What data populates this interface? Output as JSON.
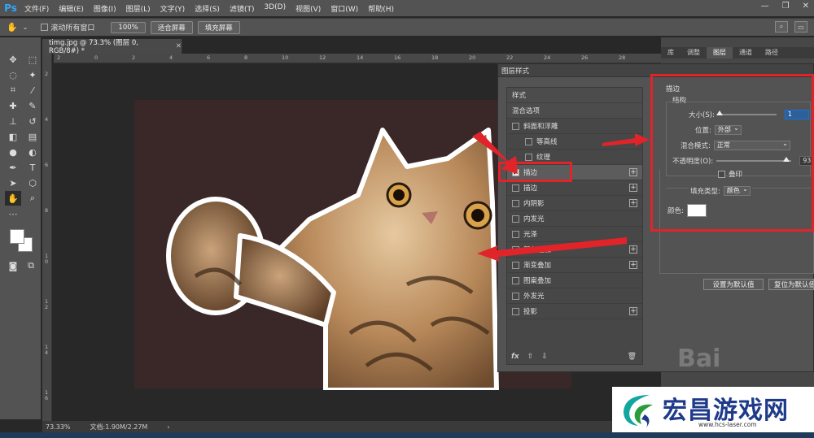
{
  "app": {
    "logo": "Ps"
  },
  "menu": [
    "文件(F)",
    "编辑(E)",
    "图像(I)",
    "图层(L)",
    "文字(Y)",
    "选择(S)",
    "滤镜(T)",
    "3D(D)",
    "视图(V)",
    "窗口(W)",
    "帮助(H)"
  ],
  "options": {
    "scroll_all_label": "滚动所有窗口",
    "zoom": "100%",
    "fit_screen": "适合屏幕",
    "fill_screen": "填充屏幕"
  },
  "document": {
    "tab_title": "timg.jpg @ 73.3% (图层 0, RGB/8#) *",
    "ruler_top": [
      "2",
      "0",
      "2",
      "4",
      "6",
      "8",
      "10",
      "12",
      "14",
      "16",
      "18",
      "20",
      "22",
      "24",
      "26",
      "28"
    ],
    "ruler_left": [
      "2",
      "4",
      "6",
      "8",
      "1\n0",
      "1\n2",
      "1\n4",
      "1\n6"
    ]
  },
  "status": {
    "zoom": "73.33%",
    "doc_info": "文档:1.90M/2.27M"
  },
  "panel_tabs": [
    "库",
    "调整",
    "图层",
    "通道",
    "路径"
  ],
  "dialog": {
    "title": "图层样式",
    "styles_header": "样式",
    "blend_options": "混合选项",
    "items": [
      {
        "label": "斜面和浮雕",
        "checked": false,
        "plus": false,
        "indent": false
      },
      {
        "label": "等高线",
        "checked": false,
        "plus": false,
        "indent": true
      },
      {
        "label": "纹理",
        "checked": false,
        "plus": false,
        "indent": true
      },
      {
        "label": "描边",
        "checked": true,
        "plus": true,
        "indent": false
      },
      {
        "label": "描边",
        "checked": false,
        "plus": true,
        "indent": false
      },
      {
        "label": "内阴影",
        "checked": false,
        "plus": true,
        "indent": false
      },
      {
        "label": "内发光",
        "checked": false,
        "plus": false,
        "indent": false
      },
      {
        "label": "光泽",
        "checked": false,
        "plus": false,
        "indent": false
      },
      {
        "label": "颜色叠加",
        "checked": false,
        "plus": true,
        "indent": false
      },
      {
        "label": "渐变叠加",
        "checked": false,
        "plus": true,
        "indent": false
      },
      {
        "label": "图案叠加",
        "checked": false,
        "plus": false,
        "indent": false
      },
      {
        "label": "外发光",
        "checked": false,
        "plus": false,
        "indent": false
      },
      {
        "label": "投影",
        "checked": false,
        "plus": true,
        "indent": false
      }
    ],
    "footer_fx": "fx",
    "stroke": {
      "title": "描边",
      "structure": "结构",
      "size_label": "大小(S):",
      "size_value": "1",
      "position_label": "位置:",
      "position_value": "外部",
      "blend_label": "混合模式:",
      "blend_value": "正常",
      "opacity_label": "不透明度(O):",
      "opacity_value": "93",
      "opacity_level": 0.93,
      "overprint_label": "叠印",
      "fill_type_label": "填充类型:",
      "fill_type_value": "颜色",
      "color_label": "颜色:",
      "color_value": "#ffffff"
    },
    "btn_set_default": "设置为默认值",
    "btn_reset_default": "复位为默认值"
  },
  "watermark": {
    "title": "宏昌游戏网",
    "url": "www.hcs-laser.com",
    "bg_brand": "Bai"
  },
  "colors": {
    "annotation_red": "#e0242a",
    "canvas_bg": "#3a2828",
    "ps_blue": "#31a8ff",
    "watermark_blue": "#1e3a8a"
  }
}
